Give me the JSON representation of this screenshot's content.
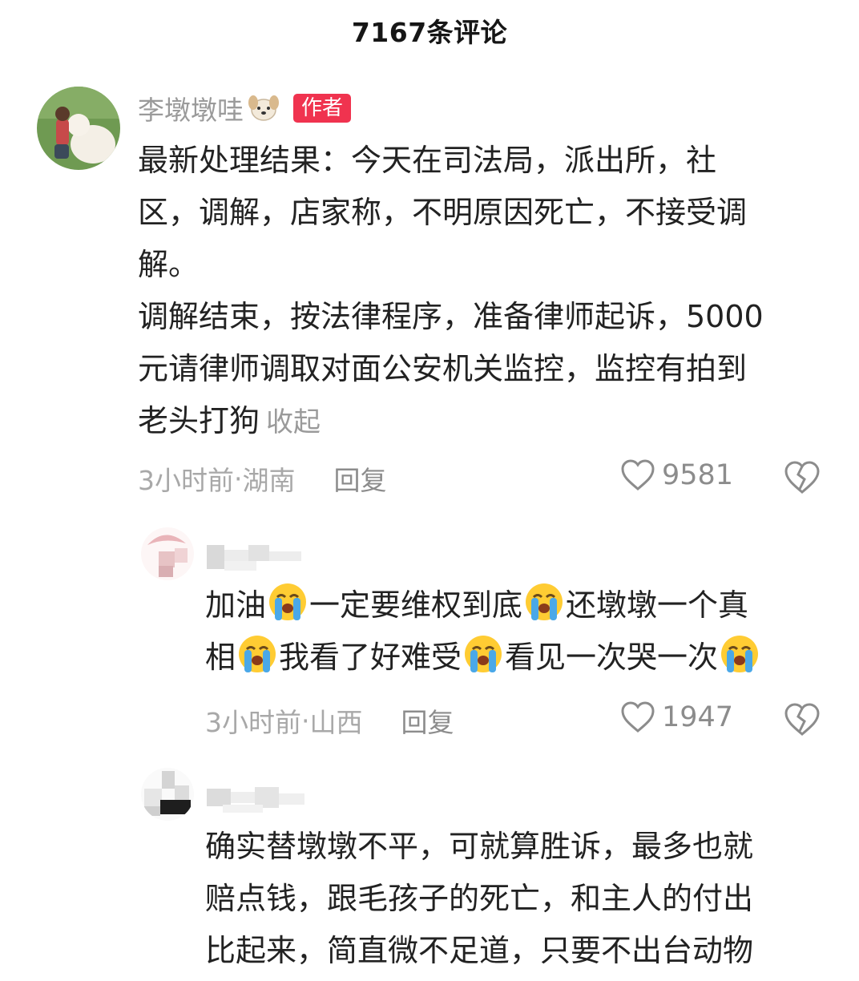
{
  "header": {
    "title": "7167条评论"
  },
  "main_comment": {
    "username": "李墩墩哇",
    "badge": "作者",
    "lines": [
      "最新处理结果：今天在司法局，派出所，社",
      "区，调解，店家称，不明原因死亡，不接受调",
      "解。",
      "调解结束，按法律程序，准备律师起诉，5000",
      "元请律师调取对面公安机关监控，监控有拍到",
      "老头打狗"
    ],
    "collapse_label": "收起",
    "time": "3小时前",
    "location": "湖南",
    "separator": " · ",
    "reply_label": "回复",
    "likes": "9581"
  },
  "reply_1": {
    "line1": {
      "a": "加油",
      "b": "一定要维权到底",
      "c": "还墩墩一个真"
    },
    "line2": {
      "a": "相",
      "b": "我看了好难受",
      "c": "看见一次哭一次"
    },
    "time": "3小时前",
    "location": "山西",
    "separator": " · ",
    "reply_label": "回复",
    "likes": "1947"
  },
  "reply_2": {
    "lines": [
      "确实替墩墩不平，可就算胜诉，最多也就",
      "赔点钱，跟毛孩子的死亡，和主人的付出",
      "比起来，简直微不足道，只要不出台动物"
    ]
  },
  "colors": {
    "badge": "#f0334f",
    "meta_text": "#a8a8a8",
    "body_text": "#222222"
  },
  "icons": {
    "like": "heart-outline-icon",
    "dislike": "broken-heart-icon",
    "emoji": "loudly-crying-face-emoji"
  }
}
